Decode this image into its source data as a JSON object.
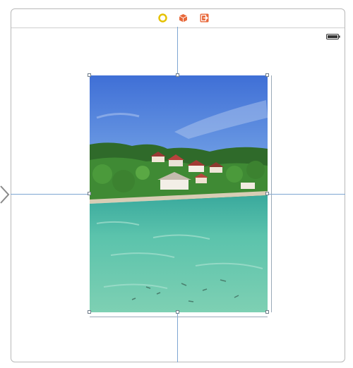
{
  "scene_dock": {
    "icons": [
      "view-controller-icon",
      "first-responder-icon",
      "exit-icon"
    ]
  },
  "status_bar": {
    "battery_icon": "battery-icon"
  },
  "image_view": {
    "content": "tropical-beach-photo"
  },
  "colors": {
    "guide": "#7ea6d2",
    "dock_yellow": "#e5c100",
    "dock_orange": "#e8683a"
  }
}
